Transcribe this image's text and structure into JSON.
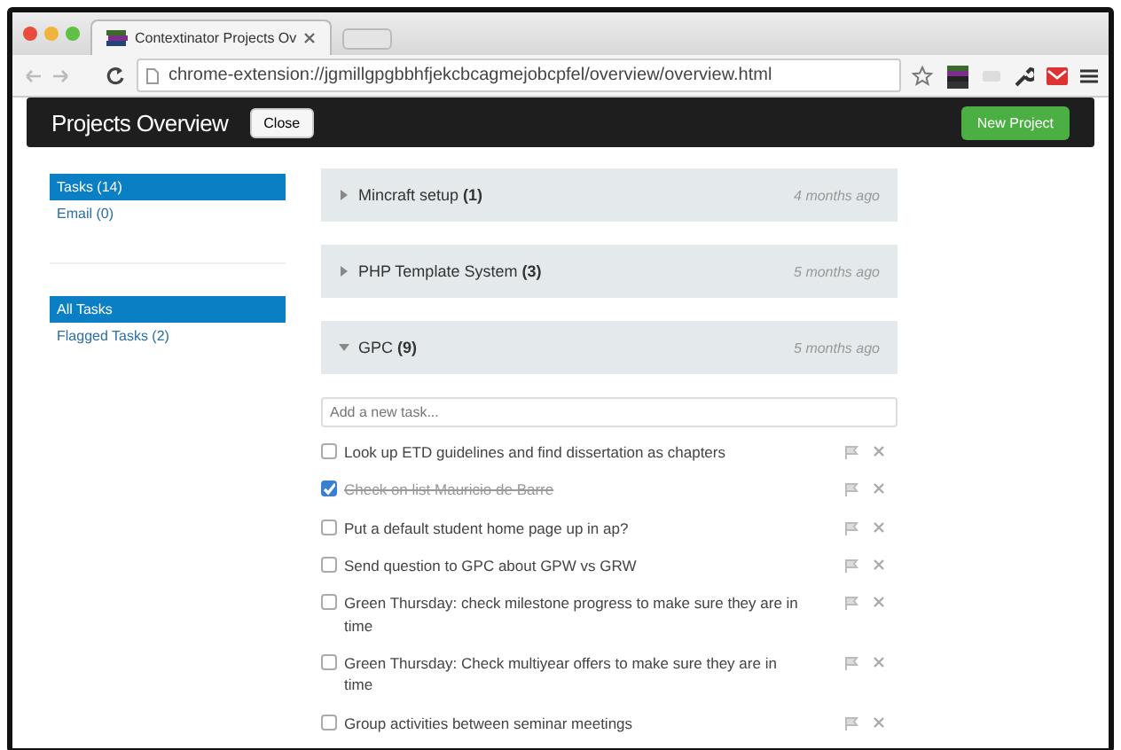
{
  "browser": {
    "tab_title": "Contextinator Projects Ov",
    "url": "chrome-extension://jgmillgpgbbhfjekcbcagmejobcpfel/overview/overview.html"
  },
  "header": {
    "title": "Projects Overview",
    "close_button": "Close",
    "new_button": "New Project"
  },
  "sidebar": {
    "groups": [
      [
        {
          "label": "Tasks (14)",
          "selected": true
        },
        {
          "label": "Email (0)",
          "selected": false
        }
      ],
      [
        {
          "label": "All Tasks",
          "selected": true
        },
        {
          "label": "Flagged Tasks (2)",
          "selected": false
        }
      ]
    ]
  },
  "projects": [
    {
      "name": "Mincraft setup",
      "count": "(1)",
      "time": "4 months ago",
      "expanded": false
    },
    {
      "name": "PHP Template System",
      "count": "(3)",
      "time": "5 months ago",
      "expanded": false
    },
    {
      "name": "GPC",
      "count": "(9)",
      "time": "5 months ago",
      "expanded": true
    }
  ],
  "new_task": {
    "placeholder": "Add a new task..."
  },
  "tasks": [
    {
      "text": "Look up ETD guidelines and find dissertation as chapters",
      "checked": false
    },
    {
      "text": "Check on list Mauricio de Barre",
      "checked": true
    },
    {
      "text": "Put a default student home page up in ap?",
      "checked": false
    },
    {
      "text": "Send question to GPC about GPW vs GRW",
      "checked": false
    },
    {
      "text": "Green Thursday: check milestone progress to make sure they are in time",
      "checked": false
    },
    {
      "text": "Green Thursday: Check multiyear offers to make sure they are in time",
      "checked": false
    },
    {
      "text": "Group activities between seminar meetings",
      "checked": false
    }
  ]
}
